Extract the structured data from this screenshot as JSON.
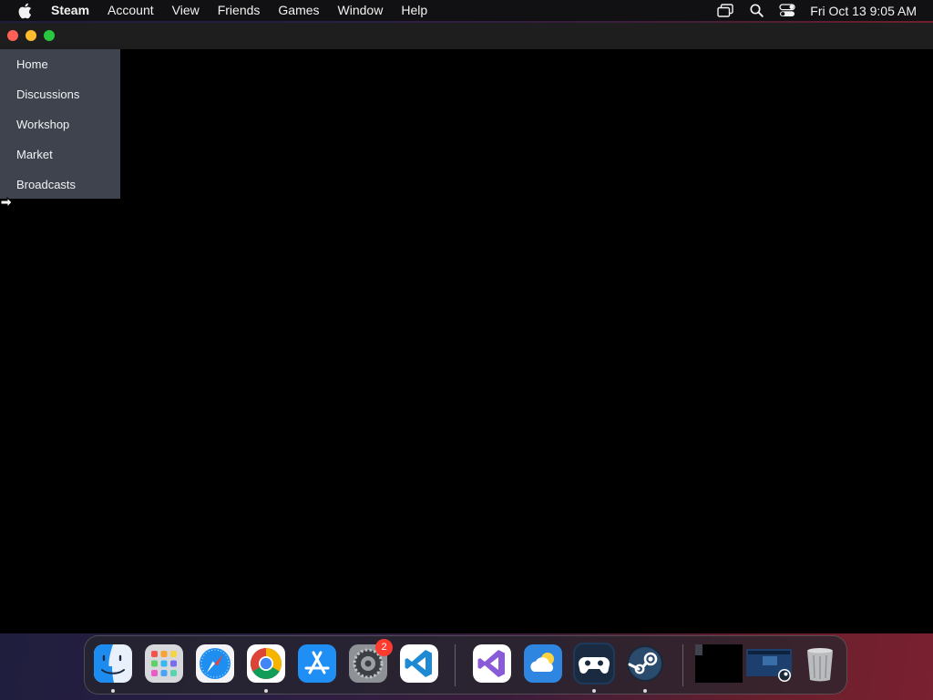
{
  "menubar": {
    "app_name": "Steam",
    "menus": [
      "Account",
      "View",
      "Friends",
      "Games",
      "Window",
      "Help"
    ],
    "clock": "Fri Oct 13  9:05 AM",
    "status_icons": [
      "screen-mirroring-icon",
      "spotlight-search-icon",
      "control-center-icon"
    ]
  },
  "window": {
    "traffic_lights": [
      "close",
      "minimize",
      "zoom"
    ],
    "nav_menu": [
      "Home",
      "Discussions",
      "Workshop",
      "Market",
      "Broadcasts"
    ]
  },
  "dock": {
    "apps": [
      {
        "name": "Finder",
        "icon": "finder-icon",
        "running": true
      },
      {
        "name": "Launchpad",
        "icon": "launchpad-icon",
        "running": false
      },
      {
        "name": "Safari",
        "icon": "safari-icon",
        "running": false
      },
      {
        "name": "Google Chrome",
        "icon": "chrome-icon",
        "running": true
      },
      {
        "name": "App Store",
        "icon": "app-store-icon",
        "running": false
      },
      {
        "name": "System Settings",
        "icon": "system-settings-icon",
        "running": false,
        "badge": "2"
      },
      {
        "name": "Visual Studio Code",
        "icon": "vscode-icon",
        "running": false
      },
      {
        "name": "Visual Studio",
        "icon": "visual-studio-icon",
        "running": false
      },
      {
        "name": "Weather",
        "icon": "weather-icon",
        "running": false
      },
      {
        "name": "Steam Link",
        "icon": "gamepad-icon",
        "running": true
      },
      {
        "name": "Steam",
        "icon": "steam-icon",
        "running": true
      }
    ],
    "recent": [
      {
        "name": "Black window thumbnail",
        "icon": "window-thumbnail-icon"
      },
      {
        "name": "Steam window thumbnail",
        "icon": "steam-thumbnail-icon"
      },
      {
        "name": "Trash",
        "icon": "trash-icon"
      }
    ]
  },
  "colors": {
    "menubar_bg": "#111113",
    "window_bg": "#000000",
    "titlebar_bg": "#1e1e1f",
    "nav_menu_bg": "#3e434d",
    "traffic_close": "#fe5f57",
    "traffic_minimize": "#febc2e",
    "traffic_zoom": "#28c840",
    "badge_red": "#ff3b30"
  }
}
